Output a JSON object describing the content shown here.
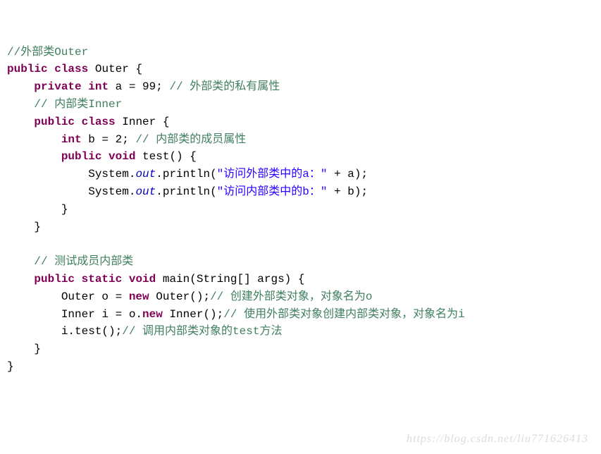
{
  "code": {
    "t01": "//外部类Outer",
    "t02a": "public",
    "t02b": "class",
    "t02c": " Outer {",
    "t03a": "private",
    "t03b": "int",
    "t03c": " a = 99; ",
    "t03d": "// 外部类的私有属性",
    "t04": "// 内部类Inner",
    "t05a": "public",
    "t05b": "class",
    "t05c": " Inner {",
    "t06a": "int",
    "t06b": " b = 2; ",
    "t06c": "// 内部类的成员属性",
    "t07a": "public",
    "t07b": "void",
    "t07c": " test() {",
    "t08a": "            System.",
    "t08b": "out",
    "t08c": ".println(",
    "t08d": "\"访问外部类中的a：\"",
    "t08e": " + a);",
    "t09a": "            System.",
    "t09b": "out",
    "t09c": ".println(",
    "t09d": "\"访问内部类中的b：\"",
    "t09e": " + b);",
    "t10": "        }",
    "t11": "    }",
    "t12": "// 测试成员内部类",
    "t13a": "public",
    "t13b": "static",
    "t13c": "void",
    "t13d": " main(String[] args) {",
    "t14a": "        Outer o = ",
    "t14b": "new",
    "t14c": " Outer();",
    "t14d": "// 创建外部类对象，对象名为o",
    "t15a": "        Inner i = o.",
    "t15b": "new",
    "t15c": " Inner();",
    "t15d": "// 使用外部类对象创建内部类对象，对象名为i",
    "t16a": "        i.test();",
    "t16b": "// 调用内部类对象的test方法",
    "t17": "    }",
    "t18": "}"
  },
  "watermark": "https://blog.csdn.net/liu771626413"
}
